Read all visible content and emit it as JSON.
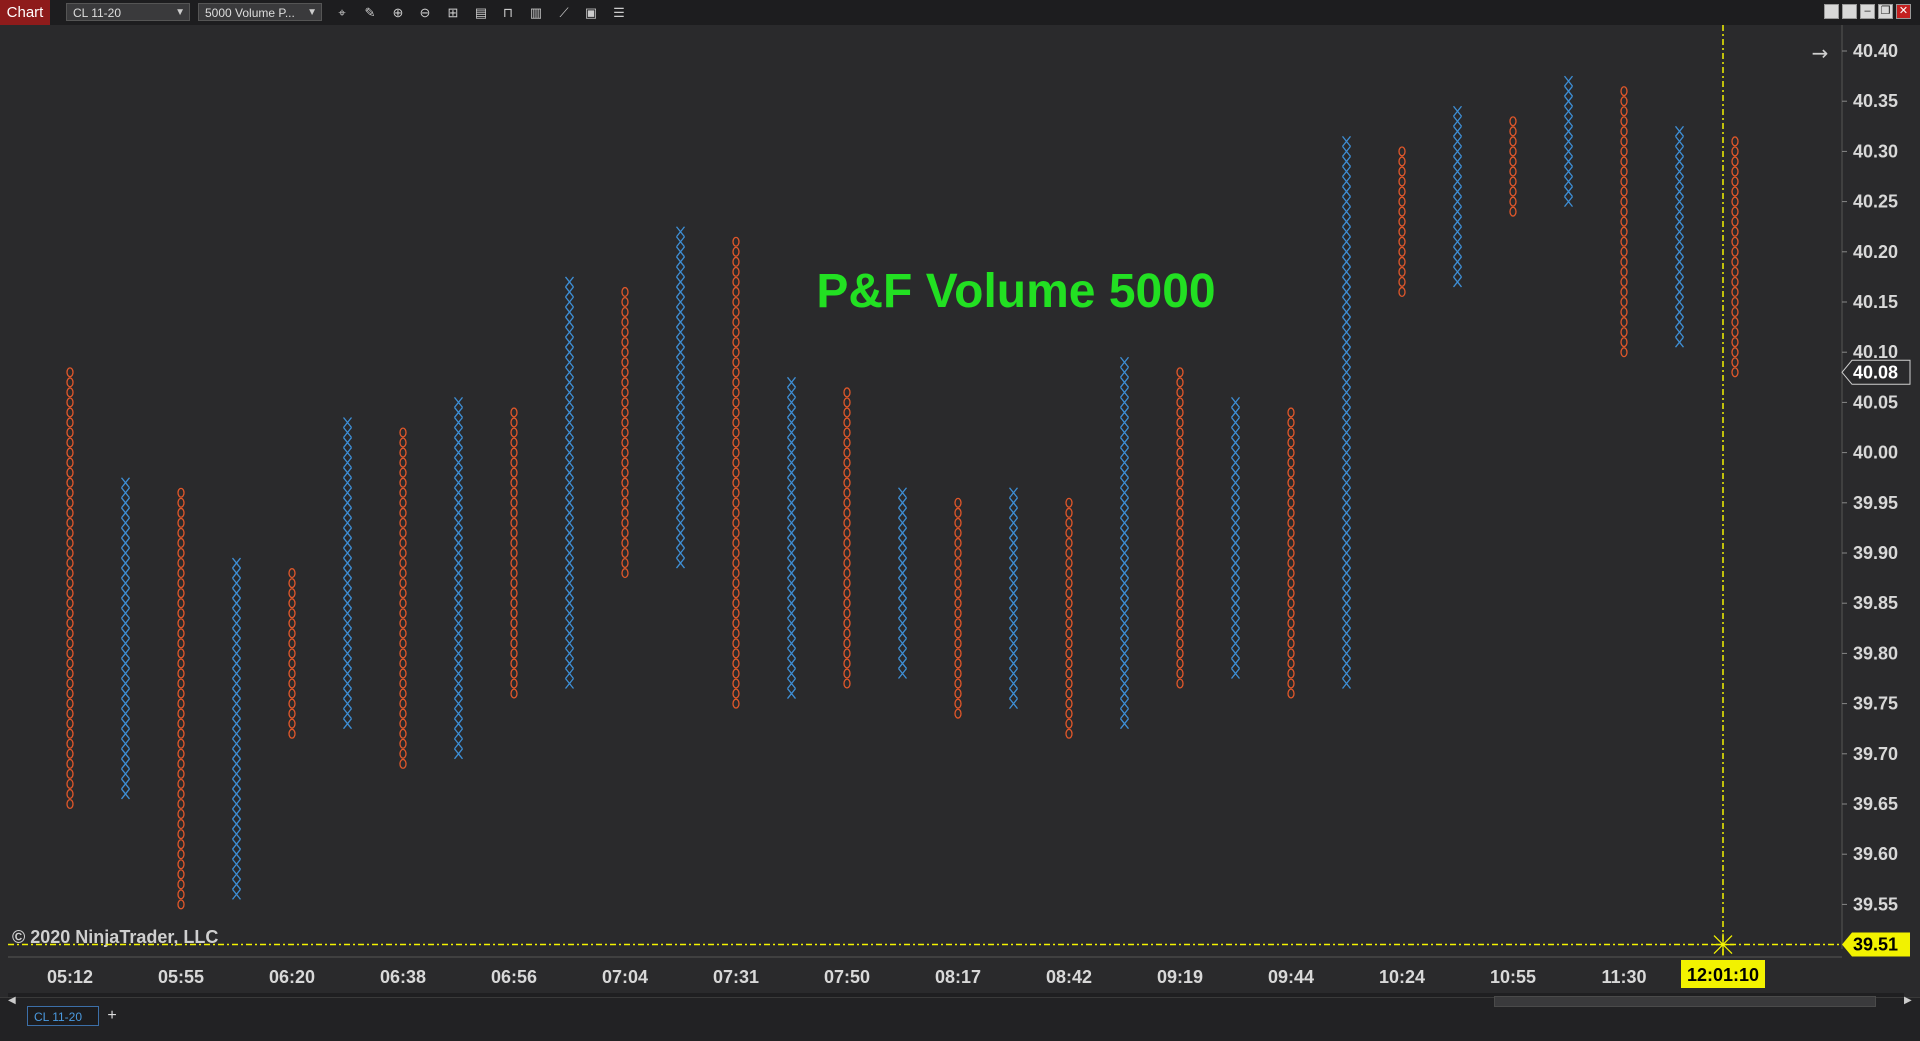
{
  "window": {
    "title_tab": "Chart",
    "instrument_select": "CL 11-20",
    "bartype_select": "5000 Volume P..."
  },
  "overlay": {
    "title": "P&F Volume 5000",
    "copyright": "© 2020 NinjaTrader, LLC"
  },
  "bottom": {
    "instrument_tab": "CL 11-20",
    "add_tab": "+"
  },
  "colors": {
    "background": "#2a2a2c",
    "x_color": "#3e8fd6",
    "o_color": "#e0572a",
    "title_color": "#22e022",
    "crosshair_color": "#f2f200",
    "price_marker_bg": "#2a2a2c"
  },
  "chart_data": {
    "type": "point-and-figure",
    "box_size": 0.01,
    "ylim": [
      39.5,
      40.42
    ],
    "y_ticks": [
      "40.40",
      "40.35",
      "40.30",
      "40.25",
      "40.20",
      "40.15",
      "40.10",
      "40.05",
      "40.00",
      "39.95",
      "39.90",
      "39.85",
      "39.80",
      "39.75",
      "39.70",
      "39.65",
      "39.60",
      "39.55"
    ],
    "x_tick_labels": [
      "05:12",
      "05:55",
      "06:20",
      "06:38",
      "06:56",
      "07:04",
      "07:31",
      "07:50",
      "08:17",
      "08:42",
      "09:19",
      "09:44",
      "10:24",
      "10:55",
      "11:30"
    ],
    "columns": [
      {
        "type": "O",
        "high": 40.08,
        "low": 39.65
      },
      {
        "type": "X",
        "high": 39.97,
        "low": 39.66
      },
      {
        "type": "O",
        "high": 39.96,
        "low": 39.55
      },
      {
        "type": "X",
        "high": 39.89,
        "low": 39.56
      },
      {
        "type": "O",
        "high": 39.88,
        "low": 39.72
      },
      {
        "type": "X",
        "high": 40.03,
        "low": 39.73
      },
      {
        "type": "O",
        "high": 40.02,
        "low": 39.69
      },
      {
        "type": "X",
        "high": 40.05,
        "low": 39.7
      },
      {
        "type": "O",
        "high": 40.04,
        "low": 39.76
      },
      {
        "type": "X",
        "high": 40.17,
        "low": 39.77
      },
      {
        "type": "O",
        "high": 40.16,
        "low": 39.88
      },
      {
        "type": "X",
        "high": 40.22,
        "low": 39.89
      },
      {
        "type": "O",
        "high": 40.21,
        "low": 39.75
      },
      {
        "type": "X",
        "high": 40.07,
        "low": 39.76
      },
      {
        "type": "O",
        "high": 40.06,
        "low": 39.77
      },
      {
        "type": "X",
        "high": 39.96,
        "low": 39.78
      },
      {
        "type": "O",
        "high": 39.95,
        "low": 39.74
      },
      {
        "type": "X",
        "high": 39.96,
        "low": 39.75
      },
      {
        "type": "O",
        "high": 39.95,
        "low": 39.72
      },
      {
        "type": "X",
        "high": 40.09,
        "low": 39.73
      },
      {
        "type": "O",
        "high": 40.08,
        "low": 39.77
      },
      {
        "type": "X",
        "high": 40.05,
        "low": 39.78
      },
      {
        "type": "O",
        "high": 40.04,
        "low": 39.76
      },
      {
        "type": "X",
        "high": 40.31,
        "low": 39.77
      },
      {
        "type": "O",
        "high": 40.3,
        "low": 40.16
      },
      {
        "type": "X",
        "high": 40.34,
        "low": 40.17
      },
      {
        "type": "O",
        "high": 40.33,
        "low": 40.24
      },
      {
        "type": "X",
        "high": 40.37,
        "low": 40.25
      },
      {
        "type": "O",
        "high": 40.36,
        "low": 40.1
      },
      {
        "type": "X",
        "high": 40.32,
        "low": 40.11
      },
      {
        "type": "O",
        "high": 40.31,
        "low": 40.08
      }
    ],
    "last_price": "40.08",
    "crosshair_price": "39.51",
    "crosshair_time": "12:01:10",
    "crosshair_column": 30
  }
}
